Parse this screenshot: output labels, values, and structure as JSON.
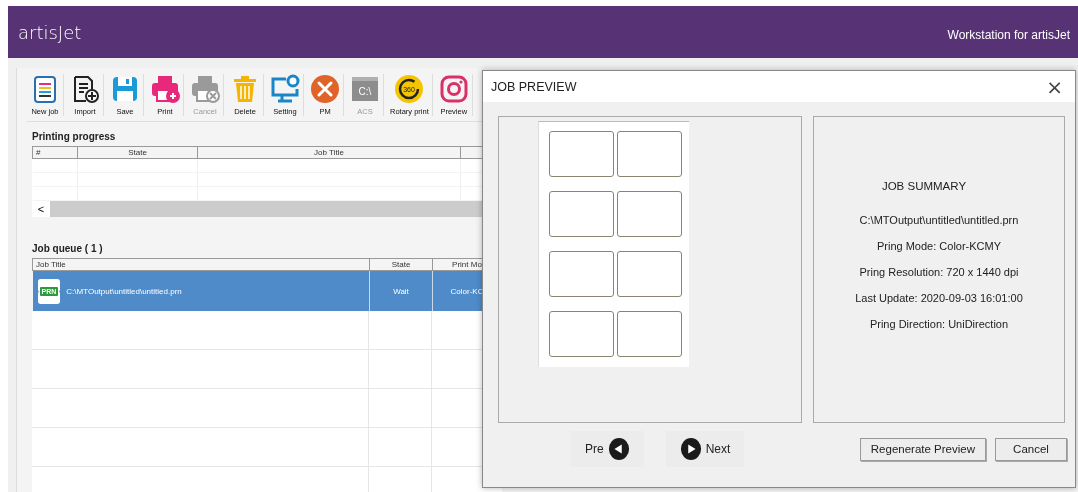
{
  "header": {
    "logo": "artisJet",
    "title": "Workstation for artisJet"
  },
  "toolbar": [
    {
      "kind": "new",
      "label": "New job",
      "disabled": false
    },
    {
      "kind": "import",
      "label": "Import",
      "disabled": false
    },
    {
      "kind": "save",
      "label": "Save",
      "disabled": false
    },
    {
      "kind": "print",
      "label": "Print",
      "disabled": false
    },
    {
      "kind": "cancel",
      "label": "Cancel",
      "disabled": true
    },
    {
      "kind": "delete",
      "label": "Delete",
      "disabled": false
    },
    {
      "kind": "setting",
      "label": "Setting",
      "disabled": false
    },
    {
      "kind": "pm",
      "label": "PM",
      "disabled": false
    },
    {
      "kind": "acs",
      "label": "ACS",
      "disabled": true,
      "icon_text": "C:\\"
    },
    {
      "kind": "rotary",
      "label": "Rotary print",
      "disabled": false,
      "icon_text": "360"
    },
    {
      "kind": "preview",
      "label": "Preview",
      "disabled": false
    }
  ],
  "printing_progress": {
    "title": "Printing progress",
    "columns": [
      "#",
      "State",
      "Job Title"
    ],
    "scroll_button": "<"
  },
  "job_queue": {
    "title": "Job queue ( 1 )",
    "columns": [
      "Job Title",
      "State",
      "Print Mo"
    ],
    "rows": [
      {
        "file_badge": "PRN",
        "job_title": "C:\\MTOutput\\untitled\\untitled.prn",
        "state": "Wait",
        "print_mode": "Color-KC",
        "selected": true
      }
    ]
  },
  "dialog": {
    "title": "JOB PREVIEW",
    "close": "×",
    "summary": {
      "title": "JOB SUMMARY",
      "lines": [
        "C:\\MTOutput\\untitled\\untitled.prn",
        "Pring Mode: Color-KCMY",
        "Pring Resolution: 720 x 1440 dpi",
        "Last Update: 2020-09-03 16:01:00",
        "Pring Direction: UniDirection"
      ]
    },
    "pre": "Pre",
    "next": "Next",
    "buttons": [
      "Regenerate Preview",
      "Cancel"
    ]
  }
}
